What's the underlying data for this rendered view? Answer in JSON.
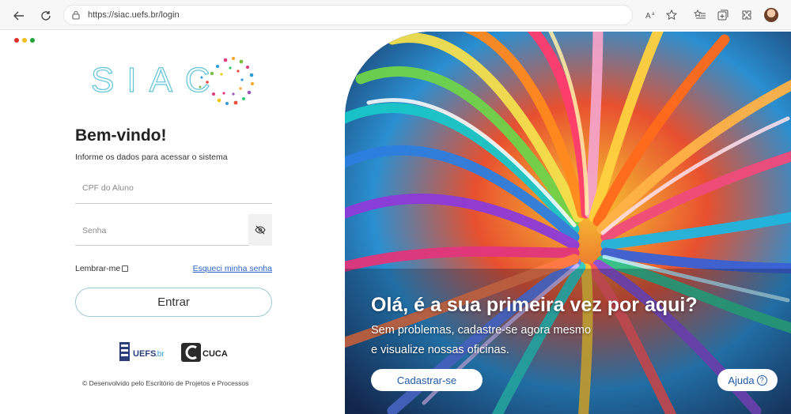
{
  "browser": {
    "url": "https://siac.uefs.br/login",
    "icons": [
      "back-icon",
      "refresh-icon",
      "lock-icon",
      "read-aloud-icon",
      "favorite-icon",
      "favorites-list-icon",
      "collections-icon",
      "extensions-icon",
      "profile-avatar"
    ]
  },
  "window_dots": [
    "#e0302a",
    "#f3c01b",
    "#20a33b"
  ],
  "login": {
    "logo_text": "SIAC",
    "title": "Bem-vindo!",
    "subtitle": "Informe os dados para acessar o sistema",
    "cpf_label": "CPF do Aluno",
    "password_label": "Senha",
    "remember_label": "Lembrar-me",
    "forgot_link": "Esqueci minha senha",
    "submit_label": "Entrar",
    "partner_uefs": "UEFS",
    "partner_uefs_suffix": ".br",
    "partner_cuca": "CUCA",
    "footer": "© Desenvolvido pelo Escritório de Projetos e Processos"
  },
  "hero": {
    "headline": "Olá, é a sua primeira vez por aqui?",
    "line1": "Sem problemas, cadastre-se agora mesmo",
    "line2": "e visualize nossas oficinas.",
    "register_label": "Cadastrar-se",
    "help_label": "Ajuda",
    "help_icon_glyph": "?"
  },
  "colors": {
    "accent": "#1f5aa6",
    "button_border": "#9ec9d7",
    "link": "#2b64c6",
    "logo_stroke": "#5ec4d8"
  }
}
